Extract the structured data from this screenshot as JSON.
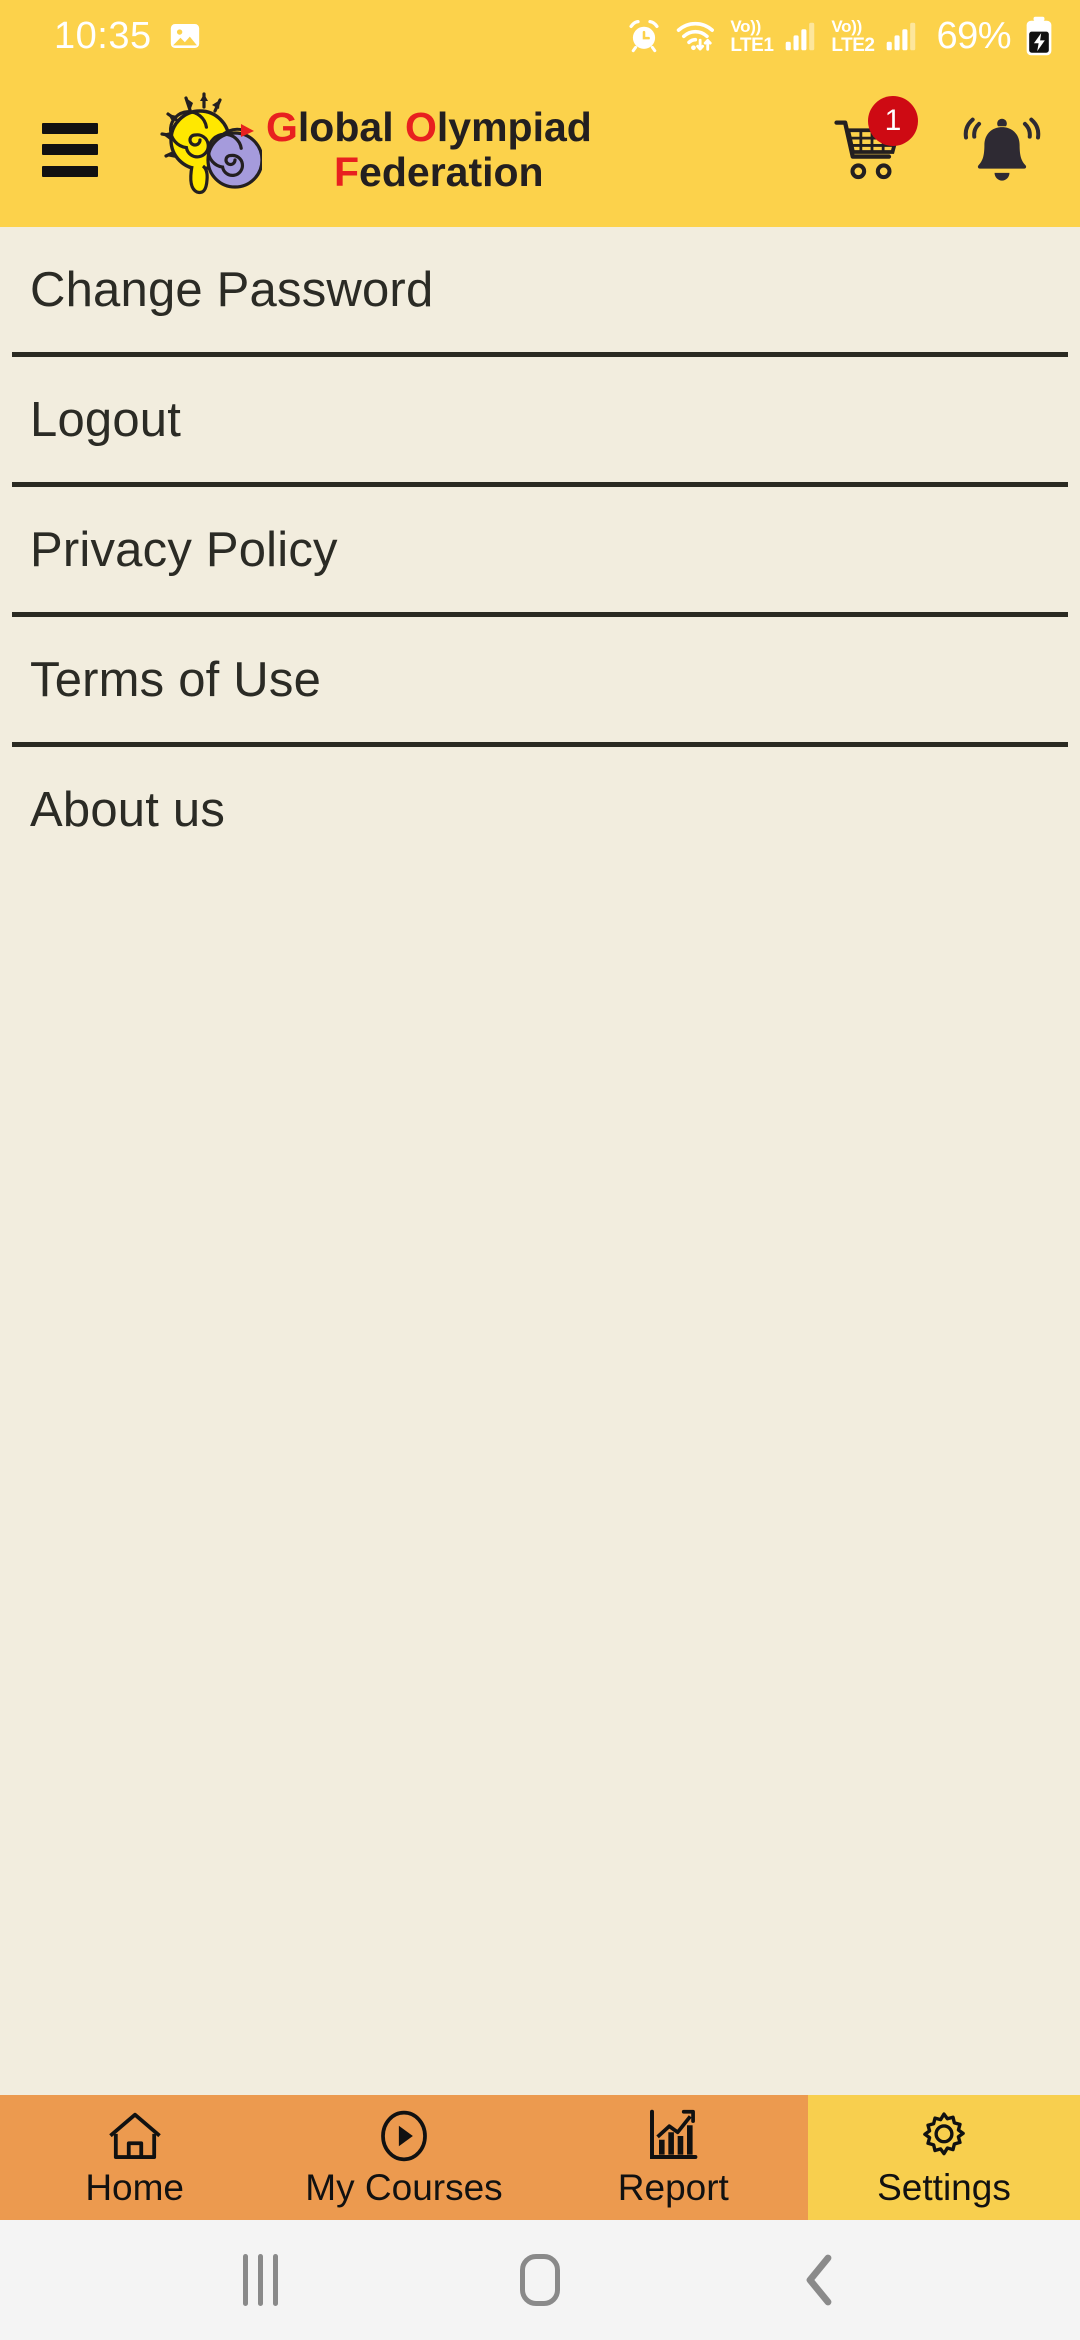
{
  "status_bar": {
    "time": "10:35",
    "icons": [
      "gallery-icon",
      "alarm-icon",
      "wifi-icon",
      "signal-icon",
      "battery-icon"
    ],
    "volte1_label_top": "Vo))",
    "volte1_label_bottom": "LTE1",
    "volte2_label_top": "Vo))",
    "volte2_label_bottom": "LTE2",
    "battery_percent": "69%"
  },
  "header": {
    "menu_icon": "hamburger-menu-icon",
    "brand_line1_cap": "G",
    "brand_line1_rest": "lobal ",
    "brand_line1_cap2": "O",
    "brand_line1_rest2": "lympiad",
    "brand_line2_cap": "F",
    "brand_line2_rest": "ederation",
    "brand_full": "Global Olympiad Federation",
    "cart_icon": "shopping-cart-icon",
    "cart_badge_count": "1",
    "notification_icon": "bell-ring-icon",
    "background_color": "#FCD24B"
  },
  "menu": {
    "items": [
      {
        "label": "Change Password"
      },
      {
        "label": "Logout"
      },
      {
        "label": "Privacy Policy"
      },
      {
        "label": "Terms of Use"
      },
      {
        "label": "About us"
      }
    ],
    "background_color": "#F2EDDE",
    "divider_color": "#2B2A22"
  },
  "bottom_nav": {
    "inactive_color": "#EC9A4F",
    "active_color": "#F8CF4E",
    "tabs": [
      {
        "label": "Home",
        "icon": "home-icon",
        "active": false
      },
      {
        "label": "My Courses",
        "icon": "play-circle-icon",
        "active": false
      },
      {
        "label": "Report",
        "icon": "bar-chart-icon",
        "active": false
      },
      {
        "label": "Settings",
        "icon": "gear-icon",
        "active": true
      }
    ]
  },
  "android_nav": {
    "recents": "recents-icon",
    "home": "home-pill-icon",
    "back": "back-chevron-icon"
  }
}
